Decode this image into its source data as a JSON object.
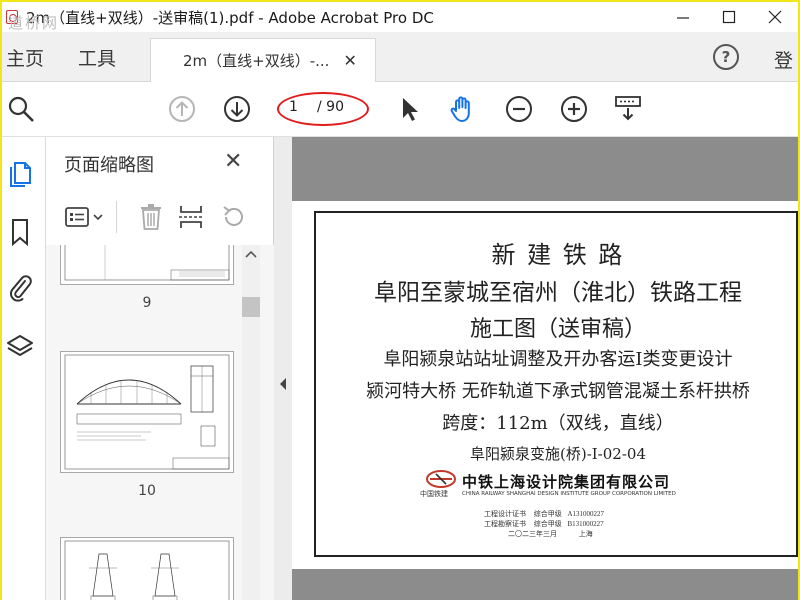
{
  "window": {
    "title": "2m（直线+双线）-送审稿(1).pdf - Adobe Acrobat Pro DC",
    "watermark": "道桥网"
  },
  "tabbar": {
    "home": "主页",
    "tools": "工具",
    "doc_tab": "2m（直线+双线）-...",
    "login": "登"
  },
  "toolbar": {
    "current_page": "1",
    "total_pages": "/ 90"
  },
  "panel": {
    "title": "页面缩略图",
    "thumb_labels": [
      "9",
      "10"
    ]
  },
  "page": {
    "line1": "新 建 铁 路",
    "line2": "阜阳至蒙城至宿州（淮北）铁路工程",
    "line3": "施工图（送审稿）",
    "line4": "阜阳颍泉站站址调整及开办客运Ⅰ类变更设计",
    "line5": "颍河特大桥 无砟轨道下承式钢管混凝土系杆拱桥",
    "line6": "跨度：112m（双线，直线）",
    "line7": "阜阳颍泉变施(桥)-Ⅰ-02-04",
    "company_cn": "中铁上海设计院集团有限公司",
    "company_en": "CHINA RAILWAY SHANGHAI DESIGN INSTITUTE GROUP CORPORATION LIMITED",
    "logo_caption": "中国铁建",
    "cert1_label": "工程设计证书",
    "cert1_grade": "综合甲级",
    "cert1_no": "A131000227",
    "cert2_label": "工程勘察证书",
    "cert2_grade": "综合甲级",
    "cert2_no": "B131000227",
    "date": "二〇二三年三月",
    "place": "上海"
  },
  "colors": {
    "highlight_ellipse": "#e21b1b",
    "window_border": "#f2e51a",
    "accent_blue": "#1473e6",
    "viewer_bg": "#8c8c8c"
  }
}
